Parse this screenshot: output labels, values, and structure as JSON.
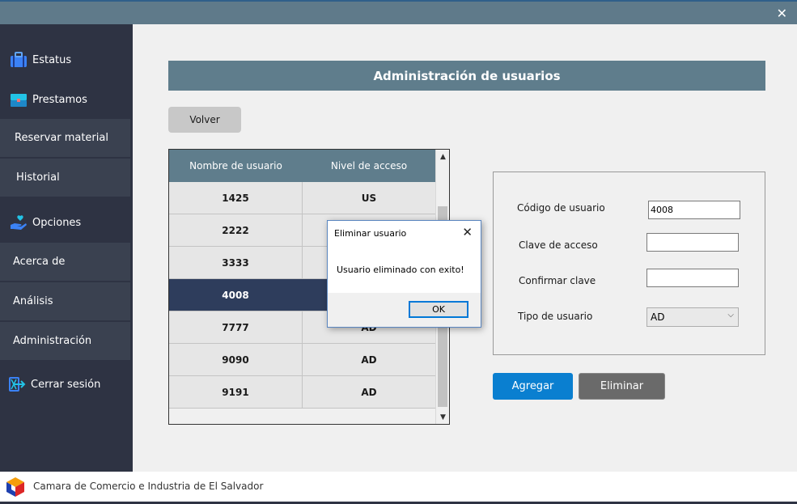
{
  "window": {
    "close_glyph": "✕"
  },
  "sidebar": {
    "status": {
      "label": "Estatus",
      "icon": "briefcase-icon"
    },
    "prestamos": {
      "label": "Prestamos",
      "icon": "toolbox-icon"
    },
    "reservar": {
      "label": "Reservar material"
    },
    "historial": {
      "label": "Historial"
    },
    "opciones": {
      "label": "Opciones",
      "icon": "hand-heart-icon"
    },
    "acerca": {
      "label": "Acerca de"
    },
    "analisis": {
      "label": "Análisis"
    },
    "administracion": {
      "label": "Administración"
    },
    "cerrar": {
      "label": "Cerrar sesión",
      "icon": "logout-icon"
    }
  },
  "header": {
    "title": "Administración de usuarios"
  },
  "toolbar": {
    "volver_label": "Volver"
  },
  "table": {
    "columns": [
      "Nombre de usuario",
      "Nivel de acceso"
    ],
    "rows": [
      {
        "user": "1425",
        "level": "US"
      },
      {
        "user": "2222",
        "level": ""
      },
      {
        "user": "3333",
        "level": ""
      },
      {
        "user": "4008",
        "level": ""
      },
      {
        "user": "7777",
        "level": "AD"
      },
      {
        "user": "9090",
        "level": "AD"
      },
      {
        "user": "9191",
        "level": "AD"
      }
    ],
    "selected_index": 3
  },
  "form": {
    "codigo_label": "Código de usuario",
    "codigo_value": "4008",
    "clave_label": "Clave de acceso",
    "clave_value": "",
    "confirmar_label": "Confirmar clave",
    "confirmar_value": "",
    "tipo_label": "Tipo de usuario",
    "tipo_value": "AD"
  },
  "actions": {
    "agregar_label": "Agregar",
    "eliminar_label": "Eliminar"
  },
  "dialog": {
    "title": "Eliminar usuario",
    "message": "Usuario eliminado con exito!",
    "ok_label": "OK"
  },
  "footer": {
    "org_name": "Camara de Comercio e Industria de El Salvador"
  },
  "colors": {
    "accent": "#0a7fd0",
    "header": "#5f7d8c",
    "sidebar": "#2e3343",
    "selected_row": "#2e3d5c"
  }
}
